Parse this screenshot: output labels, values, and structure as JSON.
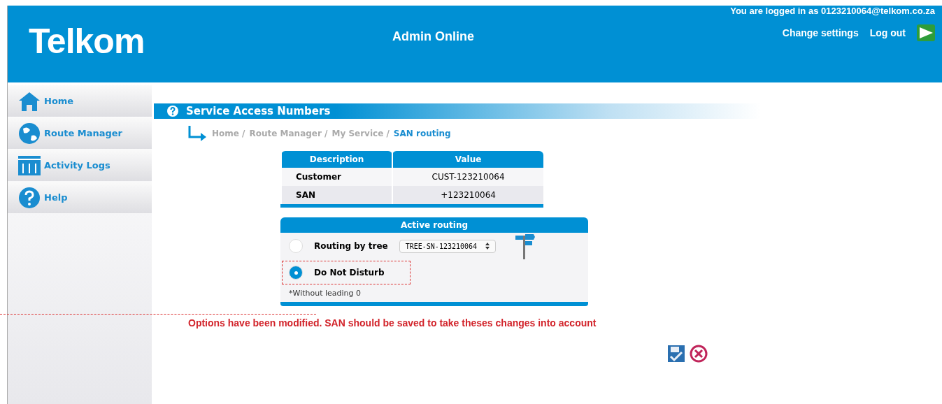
{
  "header": {
    "logo": "Telkom",
    "title": "Admin Online",
    "login_info": "You are logged in as 0123210064@telkom.co.za",
    "links": [
      "Change settings",
      "Log out"
    ]
  },
  "sidebar": {
    "items": [
      {
        "label": "Home",
        "kind": "home"
      },
      {
        "label": "Route Manager",
        "kind": "globe"
      },
      {
        "label": "Activity Logs",
        "kind": "logs"
      },
      {
        "label": "Help",
        "kind": "help"
      }
    ]
  },
  "page_title": "Service Access Numbers",
  "breadcrumb": [
    {
      "label": "Home /",
      "selected": false
    },
    {
      "label": "Route Manager /",
      "selected": false
    },
    {
      "label": "My Service /",
      "selected": false
    },
    {
      "label": "SAN routing",
      "selected": true
    }
  ],
  "info_table": {
    "columns": [
      "Description",
      "Value"
    ],
    "rows": [
      [
        "Customer",
        "CUST-123210064"
      ],
      [
        "SAN",
        "+123210064"
      ]
    ]
  },
  "routing": {
    "title": "Active routing",
    "options": [
      {
        "label": "Routing by tree",
        "selected": false,
        "kind": "tree",
        "value": "TREE-SN-123210064"
      },
      {
        "label": "Do Not Disturb",
        "selected": true,
        "kind": "plain",
        "highlighted": true
      }
    ],
    "note": "*Without leading 0"
  },
  "message": "Options have been modified. SAN should be saved to take theses changes into account"
}
